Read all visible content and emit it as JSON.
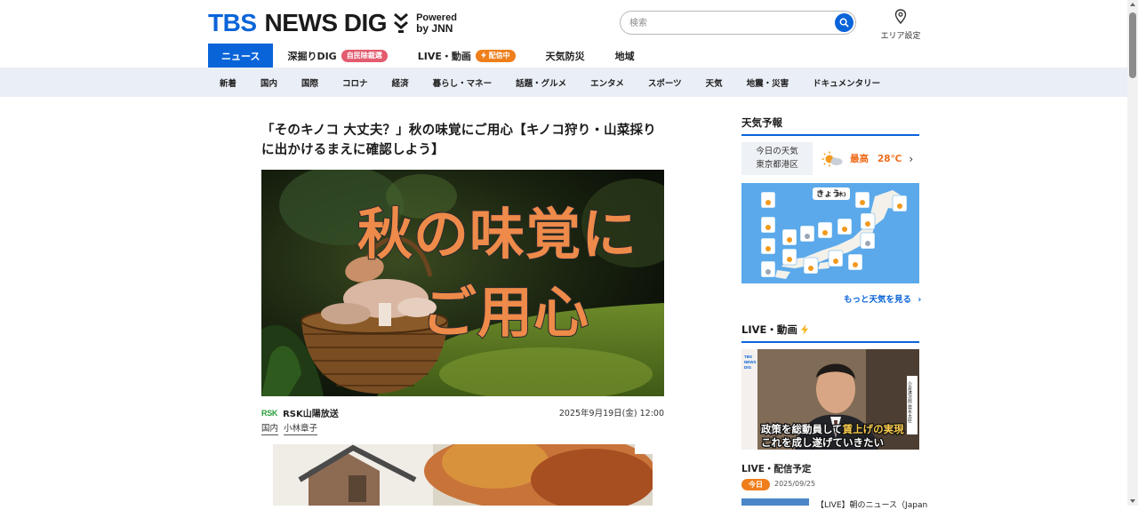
{
  "header": {
    "logo_tbs": "TBS",
    "logo_news": "NEWS DIG",
    "powered_line1": "Powered",
    "powered_line2": "by JNN",
    "search_placeholder": "検索",
    "area_label": "エリア設定"
  },
  "main_nav": [
    {
      "label": "ニュース",
      "active": true
    },
    {
      "label": "深掘りDIG",
      "badge": "自民除裁選"
    },
    {
      "label": "LIVE・動画",
      "badge": "配信中"
    },
    {
      "label": "天気防災"
    },
    {
      "label": "地域"
    }
  ],
  "sub_nav": [
    "新着",
    "国内",
    "国際",
    "コロナ",
    "経済",
    "暮らし・マネー",
    "話題・グルメ",
    "エンタメ",
    "スポーツ",
    "天気",
    "地震・災害",
    "ドキュメンタリー"
  ],
  "article": {
    "title": "「そのキノコ 大丈夫？」秋の味覚にご用心【キノコ狩り・山菜採りに出かけるまえに確認しよう】",
    "hero_line1": "秋の味覚に",
    "hero_line2": "ご用心",
    "source_logo": "RSK",
    "source": "RSK山陽放送",
    "date": "2025年9月19日(金) 12:00",
    "tags": [
      "国内",
      "小林章子"
    ]
  },
  "sidebar": {
    "weather_heading": "天気予報",
    "weather_today_line1": "今日の天気",
    "weather_today_line2": "東京都港区",
    "weather_high_label": "最高",
    "weather_high_value": "28℃",
    "map_title": "きょう",
    "map_day": "(木)",
    "more_weather": "もっと天気を見る",
    "live_heading": "LIVE・動画",
    "live_caption_line1a": "政策を総動員して",
    "live_caption_line1b": "賃上げの実現",
    "live_caption_line2": "これを成し遂げていきたい",
    "live_logo_line1": "TBS",
    "live_logo_line2": "NEWS",
    "live_logo_line3": "DIG",
    "live_side_name": "小泉進次郎 農水大臣",
    "schedule_heading": "LIVE・配信予定",
    "schedule_today": "今日",
    "schedule_date": "2025/09/25",
    "schedule_item_title": "【LIVE】朝のニュース（Japan"
  },
  "colors": {
    "brand_blue": "#0a64d9",
    "orange": "#ef7e1b",
    "badge_red": "#e25b6f",
    "subnav_bg": "#eaeef6"
  }
}
